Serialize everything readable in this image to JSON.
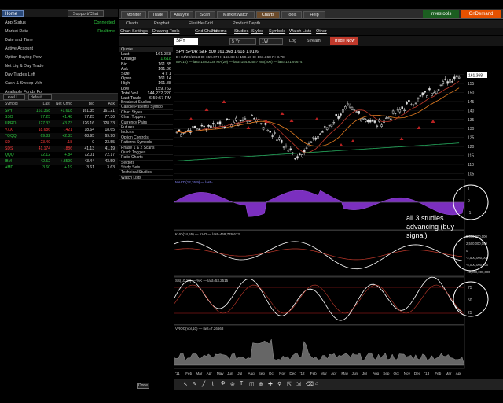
{
  "left": {
    "home": "Home",
    "support": "Support/Chat",
    "rows": [
      {
        "label": "App Status",
        "value": "Connected"
      },
      {
        "label": "Market Data",
        "value": "Realtime"
      },
      {
        "label": "Date and Time",
        "value": ""
      },
      {
        "label": "Active Account",
        "value": ""
      },
      {
        "label": "Option Buying Pow",
        "value": ""
      },
      {
        "label": "Net Liq & Day Trade",
        "value": ""
      },
      {
        "label": "Day Trades Left",
        "value": ""
      },
      {
        "label": "Cash & Sweep Veh",
        "value": ""
      },
      {
        "label": "Available Funds For",
        "value": ""
      }
    ],
    "watchlist_dd1": "Level I",
    "watchlist_dd2": "default",
    "watch_headers": [
      "Symbol",
      "Last",
      "Net Chng",
      "Bid",
      "Ask"
    ],
    "watch_rows": [
      [
        "SPY",
        "161.368",
        "+1.618",
        "161.35",
        "161.21",
        "up"
      ],
      [
        "SSO",
        "77.25",
        "+1.48",
        "77.25",
        "77.30",
        "up"
      ],
      [
        "UPRO",
        "127.33",
        "+3.73",
        "126.16",
        "128.33",
        "up"
      ],
      [
        "VXX",
        "18.686",
        "-.421",
        "18.64",
        "18.65",
        "dn"
      ],
      [
        "TQQQ",
        "69.82",
        "+2.33",
        "68.95",
        "69.90",
        "up"
      ],
      [
        "SD",
        "23.49",
        "-.18",
        "0",
        "23.55",
        "dn"
      ],
      [
        "SDS",
        "41.174",
        "-.886",
        "41.13",
        "41.19",
        "dn"
      ],
      [
        "QQQ",
        "72.12",
        "+.84",
        "72.01",
        "72.17",
        "up"
      ],
      [
        "IBM",
        "42.52",
        "+.3599",
        "43.44",
        "43.59",
        "up"
      ],
      [
        "AMD",
        "3.60",
        "+.19",
        "3.61",
        "3.63",
        "up"
      ]
    ],
    "done": "Done"
  },
  "nav": {
    "tabs": [
      "Monitor",
      "Trade",
      "Analyze",
      "Scan",
      "MarketWatch",
      "Charts",
      "Tools",
      "Help"
    ],
    "brand1": "investools",
    "brand2": "OnDemand",
    "subtabs": [
      "Charts",
      "Prophet",
      "Flexible Grid",
      "Product Depth"
    ],
    "menu": [
      "Chart Settings",
      "Drawing Tools",
      "Grid Charts",
      "Patterns",
      "Studies",
      "Styles",
      "Symbols",
      "Watch Lists",
      "Other"
    ],
    "symbol": "SPY",
    "period": "5 Yr",
    "agg": "1W",
    "log": "Log",
    "stream": "Stream",
    "trade_now": "Trade Now"
  },
  "quote": {
    "header": "Quote",
    "rows": [
      [
        "Last",
        "161.368"
      ],
      [
        "Change",
        "1.618"
      ],
      [
        "Bid",
        "161.35"
      ],
      [
        "Ask",
        "161.36"
      ],
      [
        "Size",
        "4 x 1"
      ],
      [
        "Open",
        "161.14"
      ],
      [
        "High",
        "161.88"
      ],
      [
        "Low",
        "159.762"
      ],
      [
        "Total Vol",
        "144,232,220"
      ],
      [
        "Last Trade",
        "6:59:57 PM"
      ]
    ]
  },
  "studies": [
    "Breakout Studies",
    "Candle Patterns Symbol",
    "Chart Styles",
    "Chart Toppers",
    "Currency Pairs",
    "Futures",
    "Indices",
    "Option Controls",
    "Patterns Symbols",
    "Phase 1 & 2 Scans",
    "Quick Toggles",
    "Ratio Charts",
    "Sectors",
    "Study Sets",
    "Technical Studies",
    "Watch Lists"
  ],
  "chart": {
    "title": "SPY  SPDR S&P 500  161.368  1.618  1.01%",
    "info": "D: 04/29/2013 O: 159.67 H: 163.88 L: 159.18 C: 161.368 R: 3.78",
    "ma_line": "MA(10) — last=158.2338   MA(20) — last=154.8355?   MA(200) — last=121.97674",
    "last_price": "161.368",
    "price_ticks": [
      "160",
      "155",
      "150",
      "145",
      "140",
      "135",
      "130",
      "125",
      "120",
      "115",
      "110",
      "105"
    ],
    "macd_label": "MACD(12,26,9) — last=...",
    "macd_ticks": [
      "1",
      "0",
      "-1"
    ],
    "kvo_label": "KVO(34,55) — KVO — last=469,776,673",
    "kvo_ticks": [
      "5,000,000,000",
      "2,500,000,000",
      "0",
      "-2,500,000,000",
      "-5,000,000,000",
      "-10,000,000,000"
    ],
    "ss_label": "SS(10,10) — %K — last=53.2515",
    "ss_ticks": [
      "75",
      "50",
      "25"
    ],
    "vroc_label": "VROC(Vol,10) — last=7.26668",
    "x_labels": [
      "'11",
      "Feb",
      "Mar",
      "Apr",
      "May",
      "Jun",
      "Jul",
      "Aug",
      "Sep",
      "Oct",
      "Nov",
      "Dec",
      "'12",
      "Feb",
      "Mar",
      "Apr",
      "May",
      "Jun",
      "Jul",
      "Aug",
      "Sep",
      "Oct",
      "Nov",
      "Dec",
      "'13",
      "Feb",
      "Mar",
      "Apr"
    ]
  },
  "annotation": "all 3 studies advancing (buy signal)"
}
